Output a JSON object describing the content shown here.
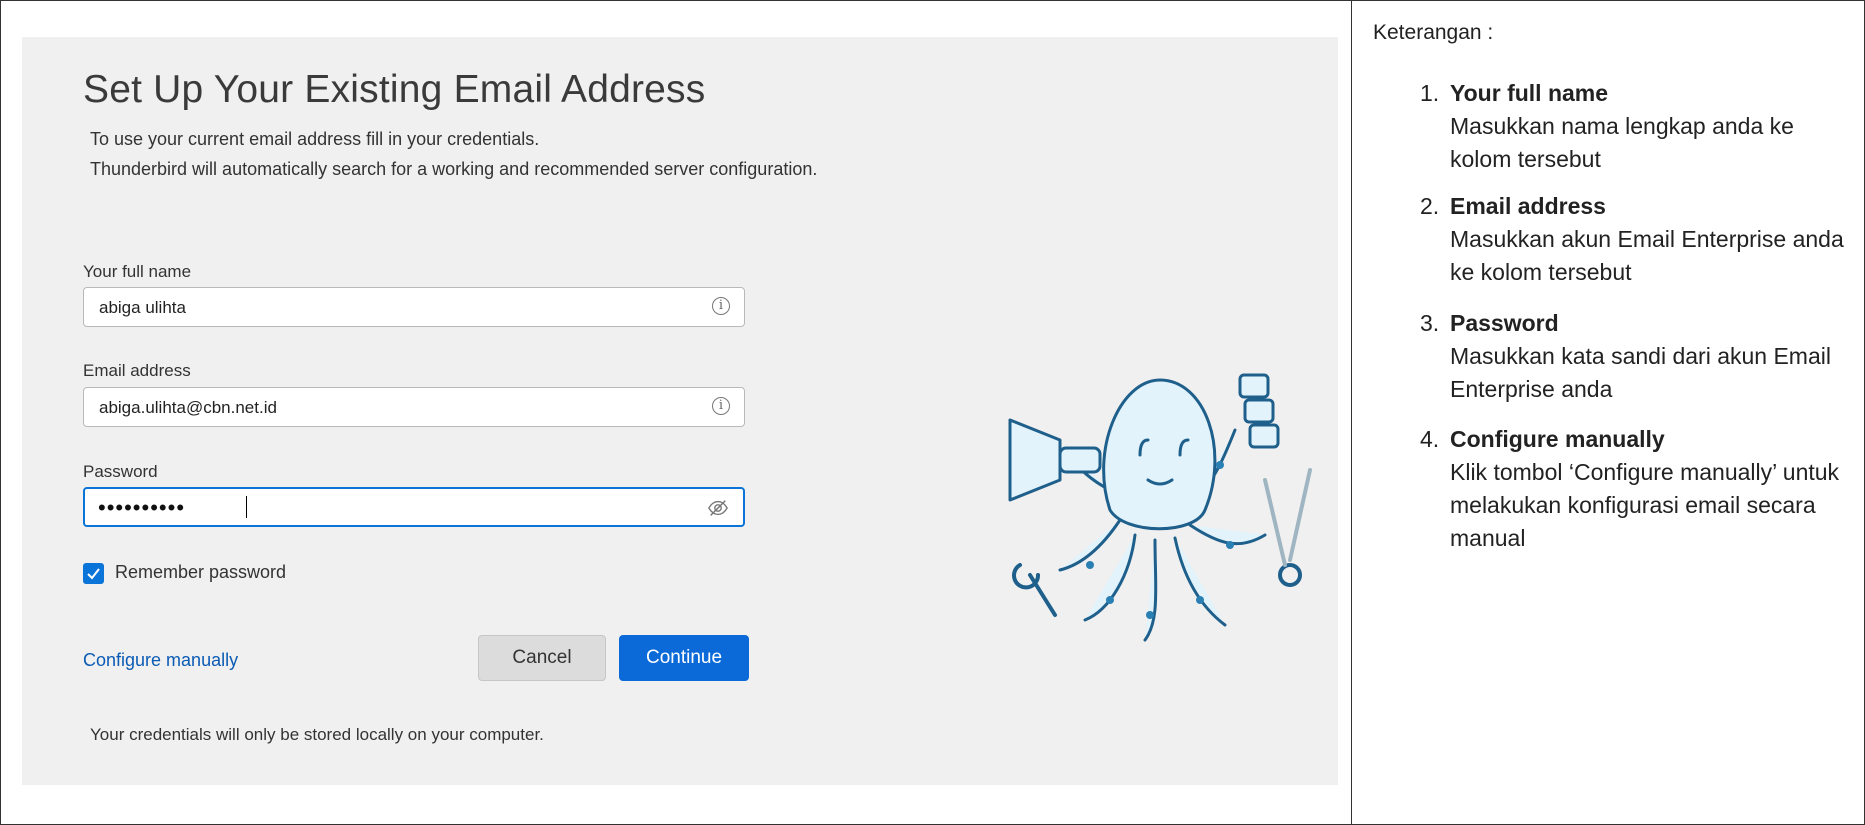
{
  "dialog": {
    "title": "Set Up Your Existing Email Address",
    "desc_line1": "To use your current email address fill in your credentials.",
    "desc_line2": "Thunderbird will automatically search for a working and recommended server configuration.",
    "fullname_label": "Your full name",
    "fullname_value": "abiga ulihta",
    "email_label": "Email address",
    "email_value": "abiga.ulihta@cbn.net.id",
    "password_label": "Password",
    "password_value": "••••••••••",
    "remember_label": "Remember password",
    "remember_checked": true,
    "configure_link": "Configure manually",
    "cancel_label": "Cancel",
    "continue_label": "Continue",
    "footnote": "Your credentials will only be stored locally on your computer.",
    "accent_color": "#0b6ad8"
  },
  "icons": {
    "info": "info-icon",
    "eye_hidden": "eye-slash-icon",
    "check": "check-icon",
    "mascot": "octopus-mascot"
  },
  "sidebar": {
    "heading": "Keterangan :",
    "items": [
      {
        "num": "1.",
        "title": "Your full name",
        "desc": "Masukkan nama lengkap anda ke kolom tersebut"
      },
      {
        "num": "2.",
        "title": "Email address",
        "desc": "Masukkan akun Email Enterprise anda ke kolom tersebut"
      },
      {
        "num": "3.",
        "title": "Password",
        "desc": "Masukkan kata sandi dari akun Email Enterprise anda"
      },
      {
        "num": "4.",
        "title": "Configure manually",
        "desc": "Klik tombol ‘Configure manually’ untuk melakukan konfigurasi email secara manual"
      }
    ]
  }
}
